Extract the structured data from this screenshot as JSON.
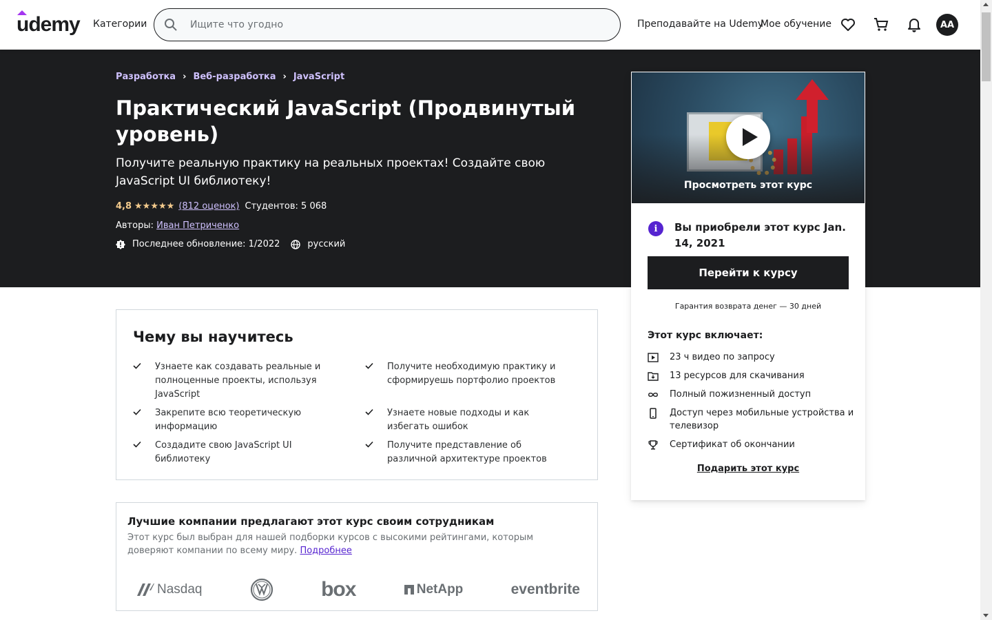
{
  "header": {
    "logo_text": "udemy",
    "categories_label": "Категории",
    "search_placeholder": "Ищите что угодно",
    "teach_label": "Преподавайте на Udemy",
    "my_learning_label": "Мое обучение",
    "avatar_initials": "AA",
    "icons": [
      "search-icon",
      "heart-icon",
      "cart-icon",
      "bell-icon"
    ]
  },
  "breadcrumb": [
    "Разработка",
    "Веб-разработка",
    "JavaScript"
  ],
  "course": {
    "title": "Практический JavaScript (Продвинутый уровень)",
    "subtitle": "Получите реальную практику на реальных проектах! Создайте свою JavaScript UI библиотеку!",
    "rating": "4,8",
    "stars": "★★★★★",
    "ratings_count": "(812 оценок)",
    "students": "Студентов: 5 068",
    "authors_label": "Авторы:",
    "author": "Иван Петриченко",
    "last_updated": "Последнее обновление: 1/2022",
    "language": "русский"
  },
  "sidebar": {
    "preview_label": "Просмотреть этот курс",
    "purchased_text": "Вы приобрели этот курс Jan. 14, 2021",
    "go_button": "Перейти к курсу",
    "guarantee": "Гарантия возврата денег — 30 дней",
    "includes_title": "Этот курс включает:",
    "includes": [
      {
        "icon": "video-icon",
        "text": "23 ч видео по запросу"
      },
      {
        "icon": "download-icon",
        "text": "13 ресурсов для скачивания"
      },
      {
        "icon": "infinity-icon",
        "text": "Полный пожизненный доступ"
      },
      {
        "icon": "mobile-icon",
        "text": "Доступ через мобильные устройства и телевизор"
      },
      {
        "icon": "trophy-icon",
        "text": "Сертификат об окончании"
      }
    ],
    "gift_label": "Подарить этот курс"
  },
  "learn": {
    "title": "Чему вы научитесь",
    "items": [
      "Узнаете как создавать реальные и полноценные проекты, используя JavaScript",
      "Получите необходимую практику и сформируешь портфолио проектов",
      "Закрепите всю теоретическую информацию",
      "Узнаете новые подходы и как избегать ошибок",
      "Создадите свою JavaScript UI библиотеку",
      "Получите представление об различной архитектуре проектов"
    ]
  },
  "companies": {
    "title": "Лучшие компании предлагают этот курс своим сотрудникам",
    "text": "Этот курс был выбран для нашей подборки курсов с высокими рейтингами, которым доверяют компании по всему миру.",
    "more_link": "Подробнее",
    "logos": [
      "Nasdaq",
      "VW",
      "box",
      "NetApp",
      "eventbrite"
    ]
  },
  "colors": {
    "hero_bg": "#1c1d1f",
    "link_purple": "#cec0fc",
    "star": "#f3ca8c",
    "brand_purple": "#a435f0",
    "info_purple": "#5624d0"
  }
}
